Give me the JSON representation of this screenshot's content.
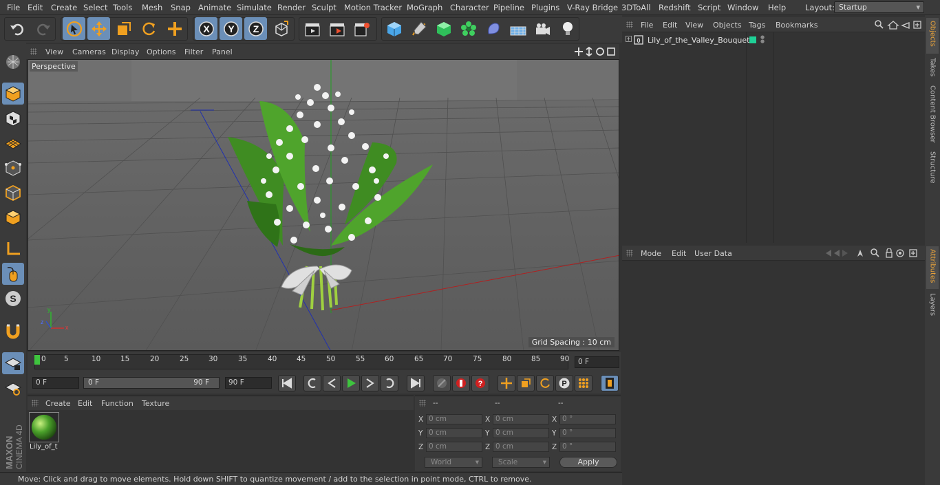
{
  "menu": [
    "File",
    "Edit",
    "Create",
    "Select",
    "Tools",
    "Mesh",
    "Snap",
    "Animate",
    "Simulate",
    "Render",
    "Sculpt",
    "Motion Tracker",
    "MoGraph",
    "Character",
    "Pipeline",
    "Plugins",
    "V-Ray Bridge",
    "3DToAll",
    "Redshift",
    "Script",
    "Window",
    "Help"
  ],
  "layout": {
    "label": "Layout:",
    "value": "Startup"
  },
  "viewport": {
    "menu": [
      "View",
      "Cameras",
      "Display",
      "Options",
      "Filter",
      "Panel"
    ],
    "camera_label": "Perspective",
    "grid_spacing": "Grid Spacing : 10 cm",
    "axis_y": "y",
    "axis_z": "z",
    "axis_x": "x"
  },
  "timeline": {
    "ticks": [
      "0",
      "5",
      "10",
      "15",
      "20",
      "25",
      "30",
      "35",
      "40",
      "45",
      "50",
      "55",
      "60",
      "65",
      "70",
      "75",
      "80",
      "85",
      "90"
    ],
    "current_frame": "0 F"
  },
  "transport": {
    "start": "0 F",
    "range_start": "0 F",
    "range_end": "90 F",
    "end": "90 F"
  },
  "material": {
    "menu": [
      "Create",
      "Edit",
      "Function",
      "Texture"
    ],
    "item_name": "Lily_of_t"
  },
  "coords": {
    "headers": [
      "--",
      "--",
      "--"
    ],
    "rows": [
      {
        "a": "X",
        "v1": "0 cm",
        "b": "X",
        "v2": "0 cm",
        "c": "X",
        "v3": "0 °"
      },
      {
        "a": "Y",
        "v1": "0 cm",
        "b": "Y",
        "v2": "0 cm",
        "c": "Y",
        "v3": "0 °"
      },
      {
        "a": "Z",
        "v1": "0 cm",
        "b": "Z",
        "v2": "0 cm",
        "c": "Z",
        "v3": "0 °"
      }
    ],
    "mode": "World",
    "scale": "Scale",
    "apply": "Apply"
  },
  "objects": {
    "menu": [
      "File",
      "Edit",
      "View",
      "Objects",
      "Tags",
      "Bookmarks"
    ],
    "item": "Lily_of_the_Valley_Bouquet",
    "tag_color": "#1fd197"
  },
  "attributes": {
    "menu": [
      "Mode",
      "Edit",
      "User Data"
    ]
  },
  "right_tabs": [
    "Objects",
    "Takes",
    "Content Browser",
    "Structure",
    "Attributes",
    "Layers"
  ],
  "brand": {
    "line1": "MAXON",
    "line2": "CINEMA 4D"
  },
  "status": "Move: Click and drag to move elements. Hold down SHIFT to quantize movement / add to the selection in point mode, CTRL to remove.",
  "colors": {
    "accent": "#6b8fb8",
    "highlight_orange": "#f0a020",
    "play_green": "#3ec43e"
  }
}
